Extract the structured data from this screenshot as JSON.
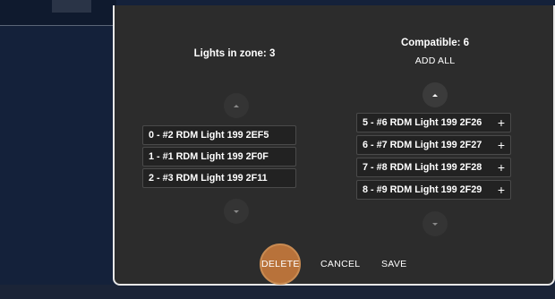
{
  "modal": {
    "zone_title": "Lights in zone: 3",
    "compatible_title": "Compatible: 6",
    "add_all_label": "ADD ALL",
    "zone_lights": [
      {
        "label": "0 - #2 RDM Light 199 2EF5"
      },
      {
        "label": "1 - #1 RDM Light 199 2F0F"
      },
      {
        "label": "2 - #3 RDM Light 199 2F11"
      }
    ],
    "compatible_lights": [
      {
        "label": "5 - #6 RDM Light 199 2F26",
        "action": "+"
      },
      {
        "label": "6 - #7 RDM Light 199 2F27",
        "action": "+"
      },
      {
        "label": "7 - #8 RDM Light 199 2F28",
        "action": "+"
      },
      {
        "label": "8 - #9 RDM Light 199 2F29",
        "action": "+"
      }
    ],
    "footer": {
      "delete_label": "DELETE",
      "cancel_label": "CANCEL",
      "save_label": "SAVE"
    }
  },
  "colors": {
    "modal_bg": "#2c2c2c",
    "delete_accent": "#b8723a",
    "page_bg": "#14213a"
  },
  "icons": {
    "scroll_up": "chevron-up-icon",
    "scroll_down": "chevron-down-icon",
    "add": "plus-icon"
  }
}
